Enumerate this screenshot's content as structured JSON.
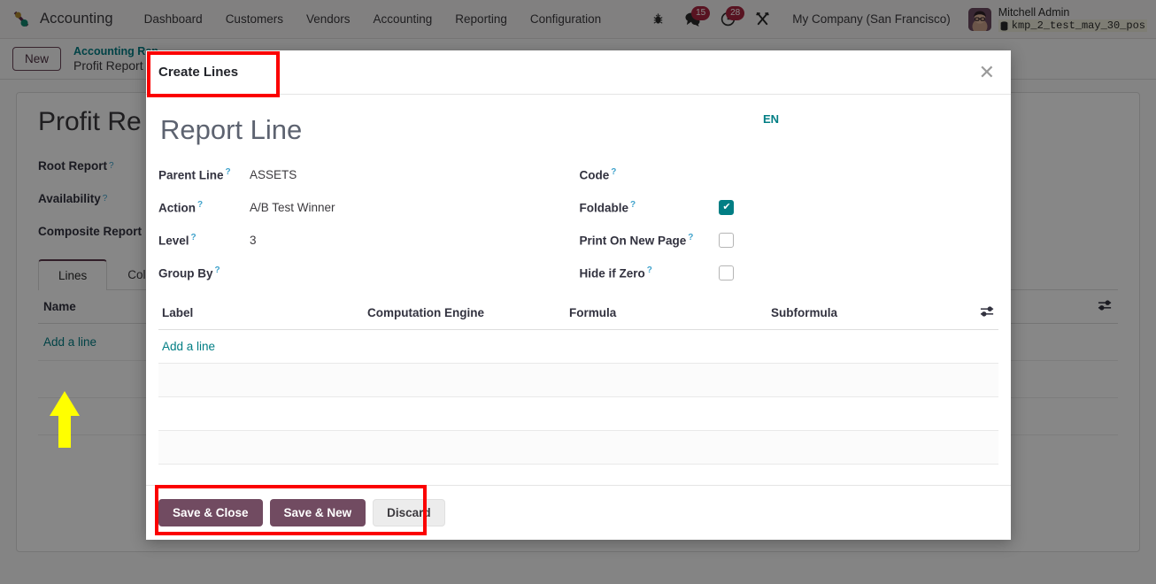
{
  "navbar": {
    "brand": "Accounting",
    "brand_logo_icon": "odoo-accounting-logo-icon",
    "menu": [
      {
        "label": "Dashboard"
      },
      {
        "label": "Customers"
      },
      {
        "label": "Vendors"
      },
      {
        "label": "Accounting"
      },
      {
        "label": "Reporting"
      },
      {
        "label": "Configuration"
      }
    ],
    "icons": {
      "debug_icon": "bug-icon",
      "messages_icon": "chat-bubble-icon",
      "messages_count": "15",
      "activities_icon": "clock-icon",
      "activities_count": "28",
      "apps_icon": "tools-icon"
    },
    "company": "My Company (San Francisco)",
    "user": {
      "name": "Mitchell Admin",
      "database": "kmp_2_test_may_30_pos",
      "database_icon": "database-icon",
      "avatar_icon": "avatar"
    }
  },
  "control_panel": {
    "new_button": "New",
    "breadcrumb_parent": "Accounting Rep",
    "breadcrumb_current": "Profit Report"
  },
  "record": {
    "title": "Profit Re",
    "fields": [
      {
        "label": "Root Report",
        "help": "?"
      },
      {
        "label": "Availability",
        "help": "?"
      },
      {
        "label": "Composite Report",
        "help": ""
      }
    ],
    "tabs": [
      {
        "label": "Lines",
        "active": true
      },
      {
        "label": "Colum",
        "active": false
      }
    ],
    "table": {
      "columns": [
        "Name"
      ],
      "add_line": "Add a line",
      "settings_icon": "sliders-icon"
    }
  },
  "modal": {
    "header_title": "Create Lines",
    "close_icon": "close-icon",
    "form_title": "Report Line",
    "language_badge": "EN",
    "left_fields": [
      {
        "label": "Parent Line",
        "help": "?",
        "value": "ASSETS"
      },
      {
        "label": "Action",
        "help": "?",
        "value": "A/B Test Winner"
      },
      {
        "label": "Level",
        "help": "?",
        "value": "3"
      },
      {
        "label": "Group By",
        "help": "?",
        "value": ""
      }
    ],
    "right_fields": [
      {
        "label": "Code",
        "help": "?",
        "type": "text",
        "value": ""
      },
      {
        "label": "Foldable",
        "help": "?",
        "type": "checkbox",
        "checked": true
      },
      {
        "label": "Print On New Page",
        "help": "?",
        "type": "checkbox",
        "checked": false
      },
      {
        "label": "Hide if Zero",
        "help": "?",
        "type": "checkbox",
        "checked": false
      }
    ],
    "table": {
      "columns": [
        "Label",
        "Computation Engine",
        "Formula",
        "Subformula"
      ],
      "settings_icon": "sliders-icon",
      "add_line": "Add a line",
      "empty_rows": 3
    },
    "footer": {
      "save_close": "Save & Close",
      "save_new": "Save & New",
      "discard": "Discard"
    }
  },
  "annotations": {
    "highlight_color": "#fb0000",
    "arrow_color": "#ffff00",
    "arrow_target": "Add a line"
  }
}
